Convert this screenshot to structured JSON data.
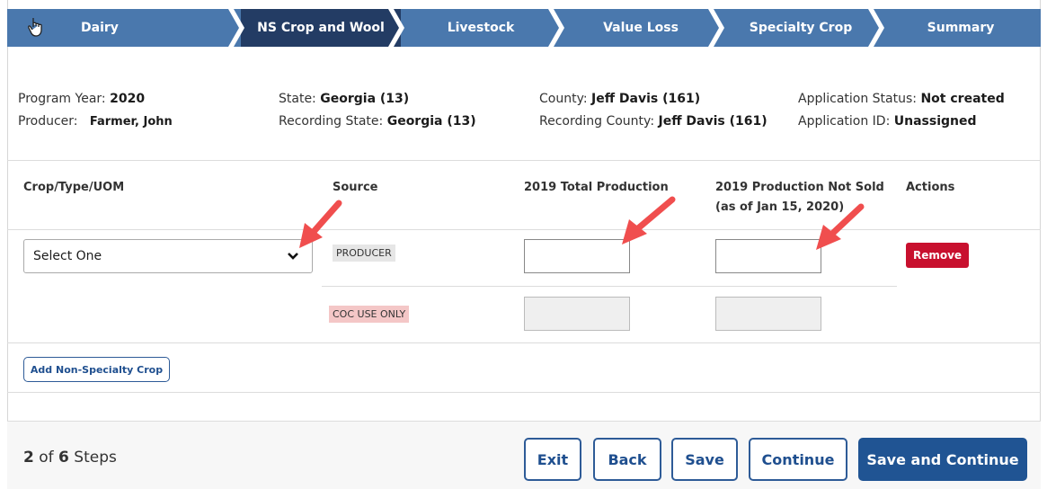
{
  "steps": [
    "Dairy",
    "NS Crop and Wool",
    "Livestock",
    "Value Loss",
    "Specialty Crop",
    "Summary"
  ],
  "info": {
    "program_year_label": "Program Year:",
    "program_year": "2020",
    "producer_label": "Producer:",
    "producer": "Farmer, John",
    "state_label": "State:",
    "state": "Georgia (13)",
    "recording_state_label": "Recording State:",
    "recording_state": "Georgia (13)",
    "county_label": "County:",
    "county": "Jeff Davis (161)",
    "recording_county_label": "Recording County:",
    "recording_county": "Jeff Davis (161)",
    "app_status_label": "Application Status:",
    "app_status": "Not created",
    "app_id_label": "Application ID:",
    "app_id": "Unassigned"
  },
  "table": {
    "col_crop": "Crop/Type/UOM",
    "col_source": "Source",
    "col_total": "2019 Total Production",
    "col_not_sold_1": "2019 Production Not Sold",
    "col_not_sold_2": "(as of Jan 15, 2020)",
    "col_actions": "Actions",
    "select_value": "Select One",
    "source_producer": "PRODUCER",
    "source_coc": "COC USE ONLY",
    "remove_label": "Remove"
  },
  "add_button": "Add Non-Specialty Crop",
  "footer": {
    "step_current": "2",
    "step_of": "of",
    "step_total": "6",
    "step_word": "Steps",
    "exit": "Exit",
    "back": "Back",
    "save": "Save",
    "continue": "Continue",
    "save_continue": "Save and Continue"
  },
  "colors": {
    "step_bar": "#4a78ad",
    "step_active": "#233c64",
    "remove": "#c8102e",
    "primary": "#205493",
    "annotation_arrow": "#f04e4e"
  },
  "icons": [
    "hand-cursor-icon",
    "chevron-down-icon",
    "annotation-arrow-icon"
  ]
}
